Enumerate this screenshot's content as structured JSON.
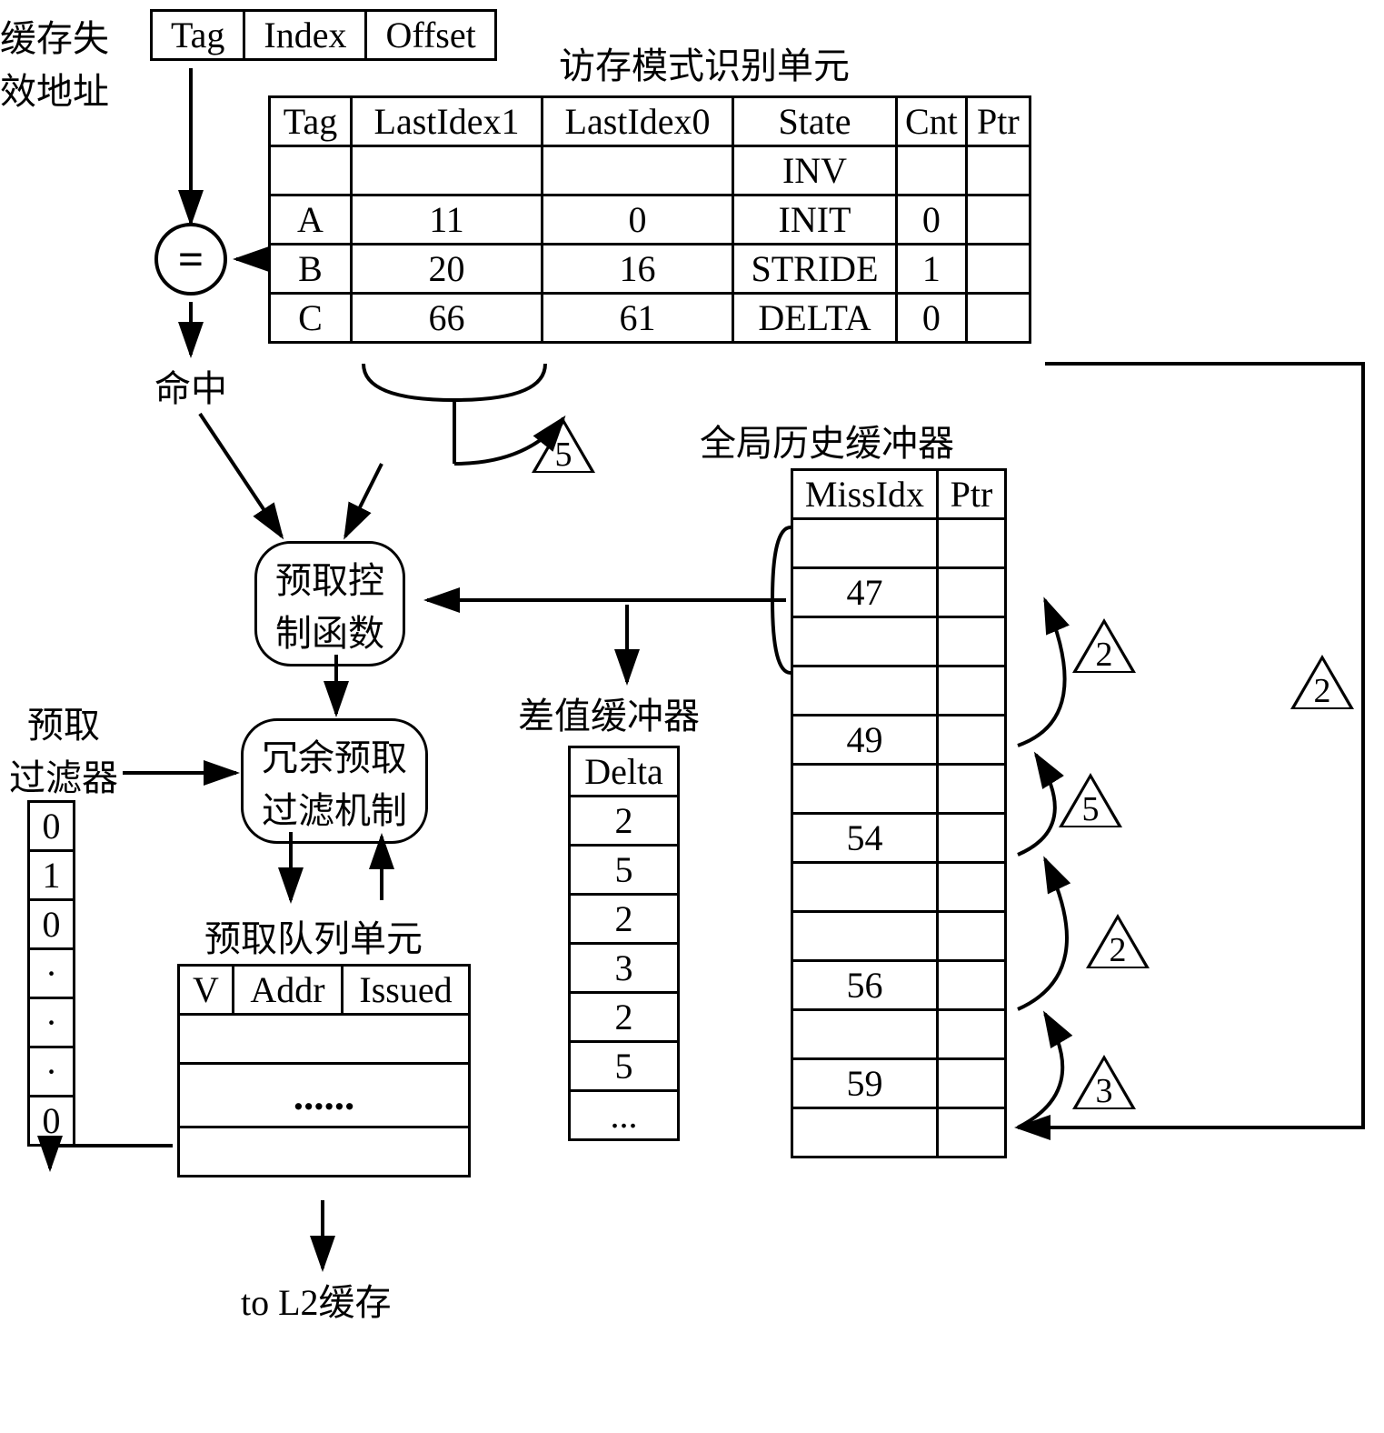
{
  "labels": {
    "cache_miss_addr_l1": "缓存失",
    "cache_miss_addr_l2": "效地址",
    "access_pattern_unit": "访存模式识别单元",
    "hit": "命中",
    "global_history_buffer": "全局历史缓冲器",
    "prefetch_ctrl_l1": "预取控",
    "prefetch_ctrl_l2": "制函数",
    "delta_buffer": "差值缓冲器",
    "prefetch_filter_l1": "预取",
    "prefetch_filter_l2": "过滤器",
    "redundant_filter_l1": "冗余预取",
    "redundant_filter_l2": "过滤机制",
    "prefetch_queue_unit": "预取队列单元",
    "to_l2_cache": "to L2缓存",
    "equals": "=",
    "dots": "......"
  },
  "addr_parts": {
    "tag": "Tag",
    "index": "Index",
    "offset": "Offset"
  },
  "pattern_table": {
    "headers": {
      "tag": "Tag",
      "lastidx1": "LastIdex1",
      "lastidx0": "LastIdex0",
      "state": "State",
      "cnt": "Cnt",
      "ptr": "Ptr"
    },
    "rows": [
      {
        "tag": "",
        "lastidx1": "",
        "lastidx0": "",
        "state": "INV",
        "cnt": "",
        "ptr": ""
      },
      {
        "tag": "A",
        "lastidx1": "11",
        "lastidx0": "0",
        "state": "INIT",
        "cnt": "0",
        "ptr": ""
      },
      {
        "tag": "B",
        "lastidx1": "20",
        "lastidx0": "16",
        "state": "STRIDE",
        "cnt": "1",
        "ptr": ""
      },
      {
        "tag": "C",
        "lastidx1": "66",
        "lastidx0": "61",
        "state": "DELTA",
        "cnt": "0",
        "ptr": ""
      }
    ]
  },
  "ghb_table": {
    "headers": {
      "missidx": "MissIdx",
      "ptr": "Ptr"
    },
    "rows": [
      {
        "missidx": "",
        "ptr": ""
      },
      {
        "missidx": "47",
        "ptr": ""
      },
      {
        "missidx": "",
        "ptr": ""
      },
      {
        "missidx": "",
        "ptr": ""
      },
      {
        "missidx": "49",
        "ptr": ""
      },
      {
        "missidx": "",
        "ptr": ""
      },
      {
        "missidx": "54",
        "ptr": ""
      },
      {
        "missidx": "",
        "ptr": ""
      },
      {
        "missidx": "",
        "ptr": ""
      },
      {
        "missidx": "56",
        "ptr": ""
      },
      {
        "missidx": "",
        "ptr": ""
      },
      {
        "missidx": "59",
        "ptr": ""
      },
      {
        "missidx": "",
        "ptr": ""
      }
    ]
  },
  "delta_table": {
    "header": "Delta",
    "rows": [
      "2",
      "5",
      "2",
      "3",
      "2",
      "5",
      "..."
    ]
  },
  "filter_values": [
    "0",
    "1",
    "0",
    "·",
    "·",
    "·",
    "0"
  ],
  "queue_table": {
    "headers": {
      "v": "V",
      "addr": "Addr",
      "issued": "Issued"
    }
  },
  "triangles": {
    "t1": "5",
    "t2": "2",
    "t3": "2",
    "t4": "5",
    "t5": "2",
    "t6": "3"
  }
}
